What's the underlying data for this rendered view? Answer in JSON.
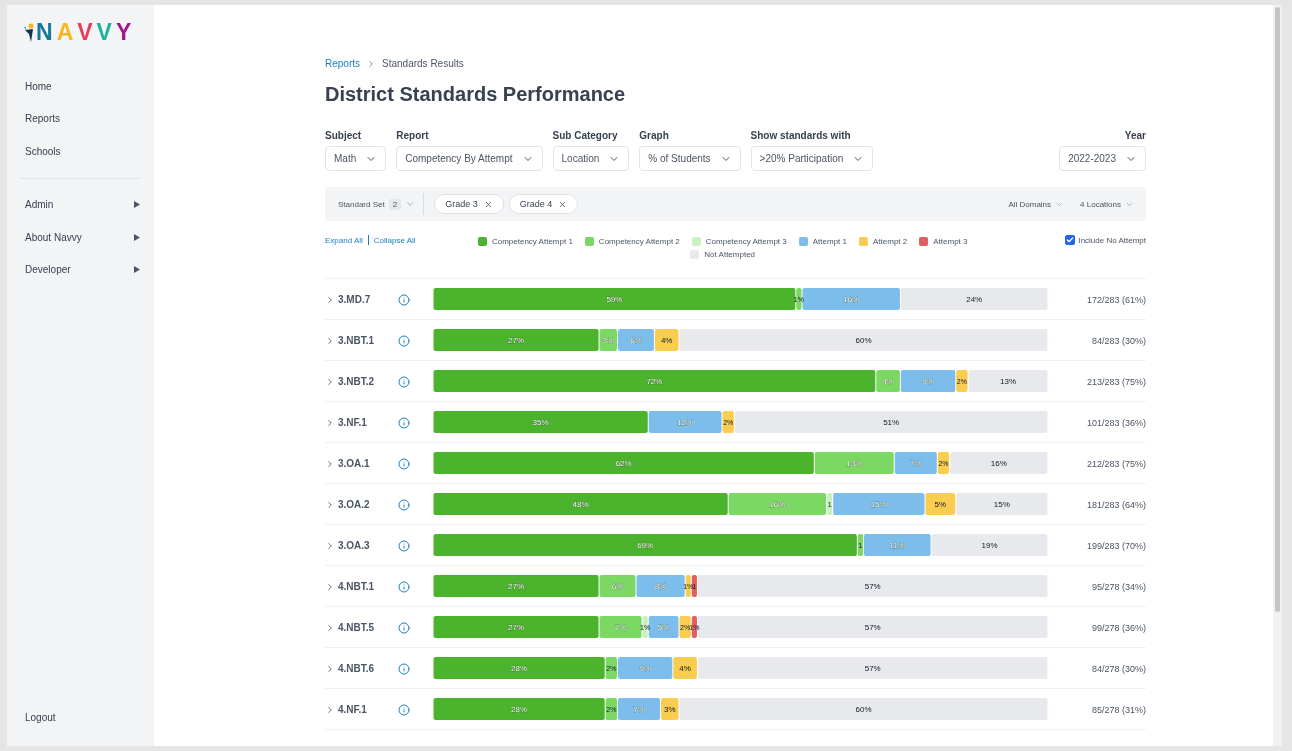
{
  "logo": {
    "letters": [
      {
        "text": "N",
        "color": "#16789a"
      },
      {
        "text": "A",
        "color": "#f6b71b"
      },
      {
        "text": "V",
        "color": "#e63b5c"
      },
      {
        "text": "V",
        "color": "#1cb39b"
      },
      {
        "text": "Y",
        "color": "#a3168c"
      }
    ]
  },
  "sidebar": {
    "items": [
      "Home",
      "Reports",
      "Schools"
    ],
    "admin_items": [
      "Admin",
      "About Navvy",
      "Developer"
    ],
    "footer": "Logout"
  },
  "breadcrumb": [
    "Reports",
    "Standards Results"
  ],
  "title": "District Standards Performance",
  "filters": [
    {
      "label": "Subject",
      "value": "Math"
    },
    {
      "label": "Report",
      "value": "Competency By Attempt"
    },
    {
      "label": "Sub Category",
      "value": "Location"
    },
    {
      "label": "Graph",
      "value": "% of Students"
    },
    {
      "label": "Show standards with",
      "value": ">20% Participation"
    }
  ],
  "year": {
    "label": "Year",
    "value": "2022-2023"
  },
  "filter_bar": {
    "standard_set": "Standard Set",
    "count": "2",
    "chips": [
      "Grade 3",
      "Grade 4"
    ],
    "domains": "All Domains",
    "locations": "4 Locations"
  },
  "expand_all": "Expand All",
  "collapse_all": "Collapse All",
  "include_no_attempt": {
    "label": "Include No Attempt",
    "checked": true
  },
  "chart_data": {
    "type": "bar",
    "orientation": "horizontal",
    "stacked": true,
    "categories": [
      "3.MD.7",
      "3.NBT.1",
      "3.NBT.2",
      "3.NF.1",
      "3.OA.1",
      "3.OA.2",
      "3.OA.3",
      "4.NBT.1",
      "4.NBT.5",
      "4.NBT.6",
      "4.NF.1"
    ],
    "series": [
      {
        "name": "Competency Attempt 1",
        "color": "#4bb32c",
        "values": [
          59,
          27,
          72,
          35,
          62,
          48,
          69,
          27,
          27,
          28,
          28
        ],
        "value_labels": [
          "59%",
          "27%",
          "72%",
          "35%",
          "62%",
          "48%",
          "69%",
          "27%",
          "27%",
          "28%",
          "28%"
        ]
      },
      {
        "name": "Competency Attempt 2",
        "color": "#7bd863",
        "values": [
          1,
          3,
          4,
          null,
          13,
          16,
          1,
          6,
          7,
          2,
          2
        ],
        "value_labels": [
          "1%",
          "3%",
          "4%",
          null,
          "13%",
          "16%",
          "1",
          "6%",
          "7%",
          "2%",
          "2%"
        ]
      },
      {
        "name": "Competency Attempt 3",
        "color": "#c9f2be",
        "values": [
          null,
          null,
          null,
          null,
          null,
          1,
          null,
          null,
          1,
          null,
          null
        ],
        "value_labels": [
          null,
          null,
          null,
          null,
          null,
          "1",
          null,
          null,
          "1%",
          null,
          null
        ]
      },
      {
        "name": "Attempt 1",
        "color": "#7cbdeb",
        "values": [
          16,
          6,
          9,
          12,
          7,
          15,
          11,
          8,
          5,
          9,
          7
        ],
        "value_labels": [
          "16%",
          "6%",
          "9%",
          "12%",
          "7%",
          "15%",
          "11%",
          "8%",
          "5%",
          "9%",
          "7%"
        ]
      },
      {
        "name": "Attempt 2",
        "color": "#f8cd50",
        "values": [
          null,
          4,
          2,
          2,
          2,
          5,
          null,
          1,
          2,
          4,
          3
        ],
        "value_labels": [
          null,
          "4%",
          "2%",
          "2%",
          "2%",
          "5%",
          null,
          "1%",
          "2%",
          "4%",
          "3%"
        ]
      },
      {
        "name": "Attempt 3",
        "color": "#e05f5f",
        "values": [
          null,
          null,
          null,
          null,
          null,
          null,
          null,
          1,
          1,
          null,
          null
        ],
        "value_labels": [
          null,
          null,
          null,
          null,
          null,
          null,
          null,
          "1",
          "1%",
          null,
          null
        ]
      },
      {
        "name": "Not Attempted",
        "color": "#e8e9ec",
        "values": [
          24,
          60,
          13,
          51,
          16,
          15,
          19,
          57,
          57,
          57,
          60
        ],
        "value_labels": [
          "24%",
          "60%",
          "13%",
          "51%",
          "16%",
          "15%",
          "19%",
          "57%",
          "57%",
          "57%",
          "60%"
        ]
      }
    ]
  },
  "counts": [
    "172/283 (61%)",
    "84/283 (30%)",
    "213/283 (75%)",
    "101/283 (36%)",
    "212/283 (75%)",
    "181/283 (64%)",
    "199/283 (70%)",
    "95/278 (34%)",
    "99/278 (36%)",
    "84/278 (30%)",
    "85/278 (31%)"
  ]
}
